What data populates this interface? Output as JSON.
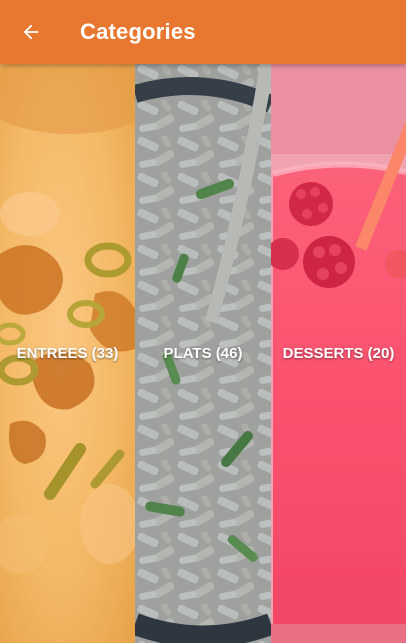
{
  "appbar": {
    "title": "Categories",
    "back_icon": "arrow-left-icon",
    "color": "#e8782f"
  },
  "categories": [
    {
      "label": "ENTREES (33)",
      "overlay": "#f28a1e"
    },
    {
      "label": "PLATS (46)",
      "overlay": "#2d4a6e"
    },
    {
      "label": "DESSERTS (20)",
      "overlay": "#f0466a"
    }
  ]
}
